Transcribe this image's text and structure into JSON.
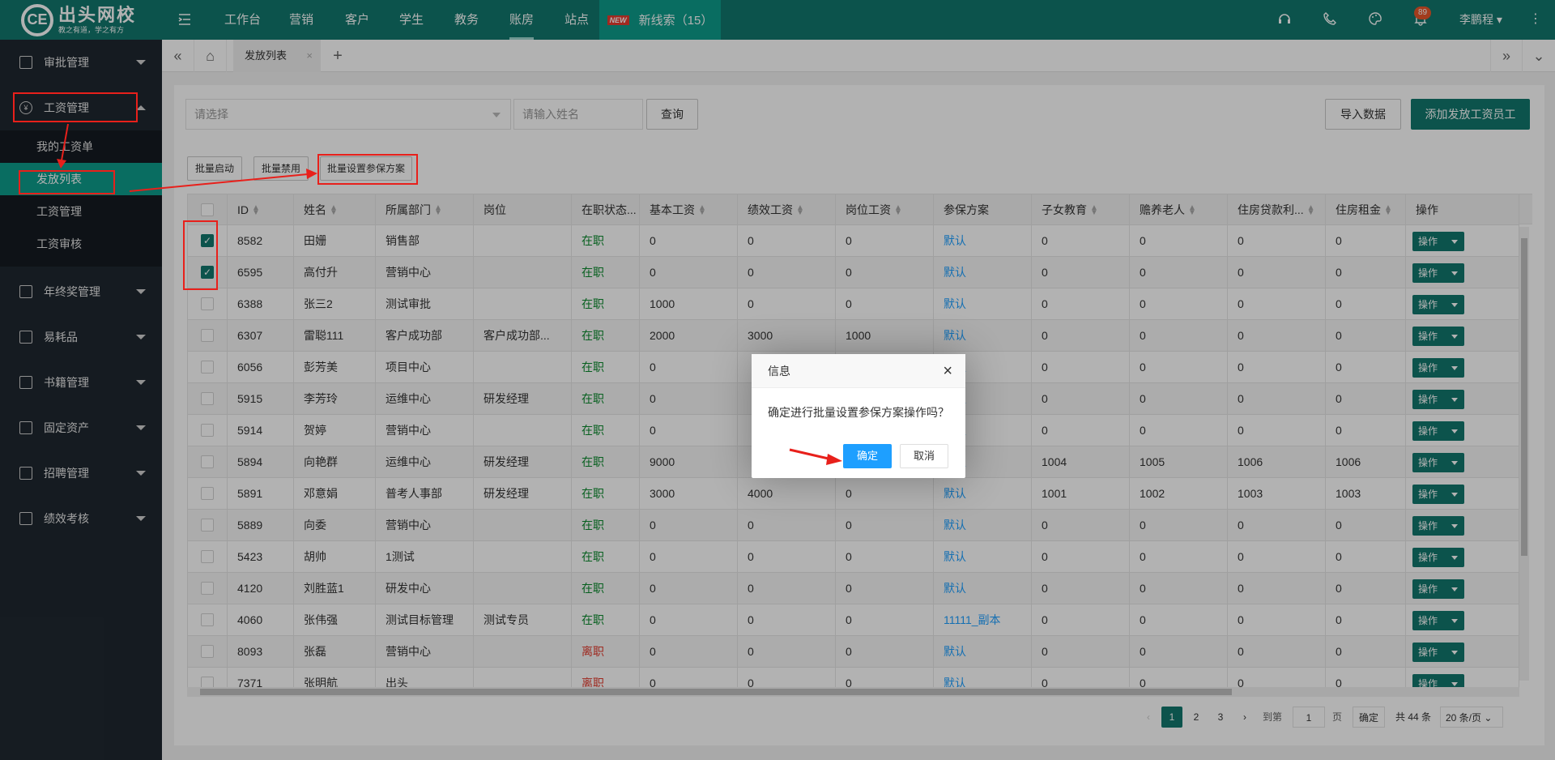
{
  "logo": {
    "brand": "出头网校",
    "slogan": "教之有道，学之有方",
    "mark": "CE"
  },
  "topnav": {
    "menu_icon": "menu-toggle-icon",
    "items": [
      "工作台",
      "营销",
      "客户",
      "学生",
      "教务",
      "账房",
      "站点"
    ],
    "active": "账房",
    "new_badge": "NEW",
    "new_lead": "新线索（15）",
    "bell_count": "89",
    "user": "李鹏程"
  },
  "sidebar": {
    "groups": [
      "审批管理",
      "工资管理",
      "年终奖管理",
      "易耗品",
      "书籍管理",
      "固定资产",
      "招聘管理",
      "绩效考核"
    ],
    "salary_sub": [
      "我的工资单",
      "发放列表",
      "工资管理",
      "工资审核"
    ],
    "active_sub": "发放列表"
  },
  "tabs": {
    "active": "发放列表",
    "add": "+"
  },
  "filters": {
    "select_placeholder": "请选择",
    "name_placeholder": "请输入姓名",
    "query": "查询",
    "import": "导入数据",
    "add": "添加发放工资员工"
  },
  "batch": {
    "enable": "批量启动",
    "disable": "批量禁用",
    "set_insurance": "批量设置参保方案"
  },
  "table": {
    "headers": [
      "ID",
      "姓名",
      "所属部门",
      "岗位",
      "在职状态...",
      "基本工资",
      "绩效工资",
      "岗位工资",
      "参保方案",
      "子女教育",
      "赡养老人",
      "住房贷款利...",
      "住房租金",
      "操作"
    ],
    "op_label": "操作",
    "rows": [
      {
        "checked": true,
        "id": "8582",
        "name": "田姗",
        "dept": "销售部",
        "post": "",
        "status": "在职",
        "base": "0",
        "perf": "0",
        "postpay": "0",
        "plan": "默认",
        "child": "0",
        "elder": "0",
        "loan": "0",
        "rent": "0"
      },
      {
        "checked": true,
        "id": "6595",
        "name": "高付升",
        "dept": "营销中心",
        "post": "",
        "status": "在职",
        "base": "0",
        "perf": "0",
        "postpay": "0",
        "plan": "默认",
        "child": "0",
        "elder": "0",
        "loan": "0",
        "rent": "0"
      },
      {
        "checked": false,
        "id": "6388",
        "name": "张三2",
        "dept": "测试审批",
        "post": "",
        "status": "在职",
        "base": "1000",
        "perf": "0",
        "postpay": "0",
        "plan": "默认",
        "child": "0",
        "elder": "0",
        "loan": "0",
        "rent": "0"
      },
      {
        "checked": false,
        "id": "6307",
        "name": "雷聪111",
        "dept": "客户成功部",
        "post": "客户成功部...",
        "status": "在职",
        "base": "2000",
        "perf": "3000",
        "postpay": "1000",
        "plan": "默认",
        "child": "0",
        "elder": "0",
        "loan": "0",
        "rent": "0"
      },
      {
        "checked": false,
        "id": "6056",
        "name": "彭芳美",
        "dept": "项目中心",
        "post": "",
        "status": "在职",
        "base": "0",
        "perf": "",
        "postpay": "",
        "plan": "默认",
        "child": "0",
        "elder": "0",
        "loan": "0",
        "rent": "0"
      },
      {
        "checked": false,
        "id": "5915",
        "name": "李芳玲",
        "dept": "运维中心",
        "post": "研发经理",
        "status": "在职",
        "base": "0",
        "perf": "",
        "postpay": "",
        "plan": "默认",
        "child": "0",
        "elder": "0",
        "loan": "0",
        "rent": "0"
      },
      {
        "checked": false,
        "id": "5914",
        "name": "贺婷",
        "dept": "营销中心",
        "post": "",
        "status": "在职",
        "base": "0",
        "perf": "",
        "postpay": "",
        "plan": "默认",
        "child": "0",
        "elder": "0",
        "loan": "0",
        "rent": "0"
      },
      {
        "checked": false,
        "id": "5894",
        "name": "向艳群",
        "dept": "运维中心",
        "post": "研发经理",
        "status": "在职",
        "base": "9000",
        "perf": "",
        "postpay": "",
        "plan": "默认",
        "child": "1004",
        "elder": "1005",
        "loan": "1006",
        "rent": "1006"
      },
      {
        "checked": false,
        "id": "5891",
        "name": "邓意娟",
        "dept": "普考人事部",
        "post": "研发经理",
        "status": "在职",
        "base": "3000",
        "perf": "4000",
        "postpay": "0",
        "plan": "默认",
        "child": "1001",
        "elder": "1002",
        "loan": "1003",
        "rent": "1003"
      },
      {
        "checked": false,
        "id": "5889",
        "name": "向委",
        "dept": "营销中心",
        "post": "",
        "status": "在职",
        "base": "0",
        "perf": "0",
        "postpay": "0",
        "plan": "默认",
        "child": "0",
        "elder": "0",
        "loan": "0",
        "rent": "0"
      },
      {
        "checked": false,
        "id": "5423",
        "name": "胡帅",
        "dept": "1测试",
        "post": "",
        "status": "在职",
        "base": "0",
        "perf": "0",
        "postpay": "0",
        "plan": "默认",
        "child": "0",
        "elder": "0",
        "loan": "0",
        "rent": "0"
      },
      {
        "checked": false,
        "id": "4120",
        "name": "刘胜蓝1",
        "dept": "研发中心",
        "post": "",
        "status": "在职",
        "base": "0",
        "perf": "0",
        "postpay": "0",
        "plan": "默认",
        "child": "0",
        "elder": "0",
        "loan": "0",
        "rent": "0"
      },
      {
        "checked": false,
        "id": "4060",
        "name": "张伟强",
        "dept": "测试目标管理",
        "post": "测试专员",
        "status": "在职",
        "base": "0",
        "perf": "0",
        "postpay": "0",
        "plan": "11111_副本",
        "child": "0",
        "elder": "0",
        "loan": "0",
        "rent": "0"
      },
      {
        "checked": false,
        "id": "8093",
        "name": "张磊",
        "dept": "营销中心",
        "post": "",
        "status": "离职",
        "base": "0",
        "perf": "0",
        "postpay": "0",
        "plan": "默认",
        "child": "0",
        "elder": "0",
        "loan": "0",
        "rent": "0"
      },
      {
        "checked": false,
        "id": "7371",
        "name": "张明航",
        "dept": "出头",
        "post": "",
        "status": "离职",
        "base": "0",
        "perf": "0",
        "postpay": "0",
        "plan": "默认",
        "child": "0",
        "elder": "0",
        "loan": "0",
        "rent": "0"
      }
    ]
  },
  "pager": {
    "pages": [
      "1",
      "2",
      "3"
    ],
    "current": "1",
    "goto_label": "到第",
    "goto_value": "1",
    "page_unit": "页",
    "confirm": "确定",
    "total": "共 44 条",
    "page_size": "20 条/页"
  },
  "dialog": {
    "title": "信息",
    "message": "确定进行批量设置参保方案操作吗？",
    "ok": "确定",
    "cancel": "取消"
  }
}
